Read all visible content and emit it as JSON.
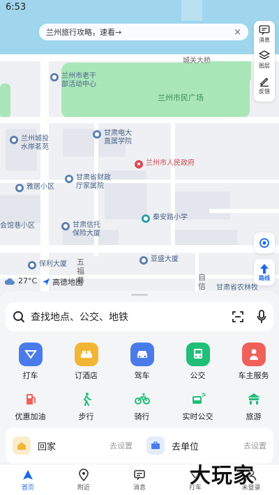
{
  "status_bar": {
    "time": "6:53"
  },
  "banner": {
    "text": "兰州旅行攻略，速看→",
    "close": "×"
  },
  "right_tools": [
    {
      "label": "消息",
      "icon": "message-icon"
    },
    {
      "label": "图层",
      "icon": "layers-icon"
    },
    {
      "label": "反馈",
      "icon": "pen-icon"
    }
  ],
  "map": {
    "pois": {
      "laogan": "兰州市老干\n部活动中心",
      "chengjian": "兰州城投\n水岸茗苑",
      "dianda": "甘肃电大\n直属学院",
      "government": "兰州市人民政府",
      "yaju": "雅居小区",
      "caizheng": "甘肃省财政\n厅家属院",
      "xintuo": "甘肃信托\n保险大厦",
      "qinan": "秦安路小学",
      "huiguan": "会馆巷小区",
      "baoli": "保利大厦",
      "yasheng": "亚盛大厦"
    },
    "streets": {
      "chengguan": "城关大桥",
      "square": "兰州市民广场",
      "wufu": "五\n福\n巷",
      "zixin": "自\n信\n路",
      "nonglin": "甘肃省农林牧\n三厅家属院"
    },
    "weather": "27°C",
    "brand": "高德地图",
    "route_label": "路线"
  },
  "search": {
    "placeholder": "查找地点、公交、地铁"
  },
  "services_row1": [
    {
      "label": "打车",
      "icon": "taxi-icon",
      "color": "#4a7bea"
    },
    {
      "label": "订酒店",
      "icon": "hotel-icon",
      "color": "#f2b636"
    },
    {
      "label": "驾车",
      "icon": "car-icon",
      "color": "#4a7bea"
    },
    {
      "label": "公交",
      "icon": "bus-icon",
      "color": "#1fbf78"
    },
    {
      "label": "车主服务",
      "icon": "owner-icon",
      "color": "#f0605a"
    }
  ],
  "services_row2": [
    {
      "label": "优惠加油",
      "icon": "fuel-icon",
      "color": "#f0605a"
    },
    {
      "label": "步行",
      "icon": "walk-icon",
      "color": "#1fbf78"
    },
    {
      "label": "骑行",
      "icon": "bike-icon",
      "color": "#1fbf78"
    },
    {
      "label": "实时公交",
      "icon": "realtime-bus-icon",
      "color": "#1fbf78"
    },
    {
      "label": "旅游",
      "icon": "travel-icon",
      "color": "#1fbf78"
    }
  ],
  "places": [
    {
      "name": "回家",
      "action": "去设置",
      "icon": "home-icon",
      "color": "#fbeccb"
    },
    {
      "name": "去单位",
      "action": "去设置",
      "icon": "briefcase-icon",
      "color": "#e4ecfb"
    }
  ],
  "bottom_nav": [
    {
      "label": "首页",
      "icon": "home-nav-icon",
      "active": true
    },
    {
      "label": "附近",
      "icon": "location-icon"
    },
    {
      "label": "消息",
      "icon": "message-icon"
    },
    {
      "label": "打车",
      "icon": "taxi-nav-icon"
    },
    {
      "label": "未登录",
      "icon": "user-icon"
    }
  ],
  "watermark": "大玩家",
  "colors": {
    "accent": "#1a6ae6",
    "park": "#a9e6b8",
    "water": "#9fd6ee"
  }
}
